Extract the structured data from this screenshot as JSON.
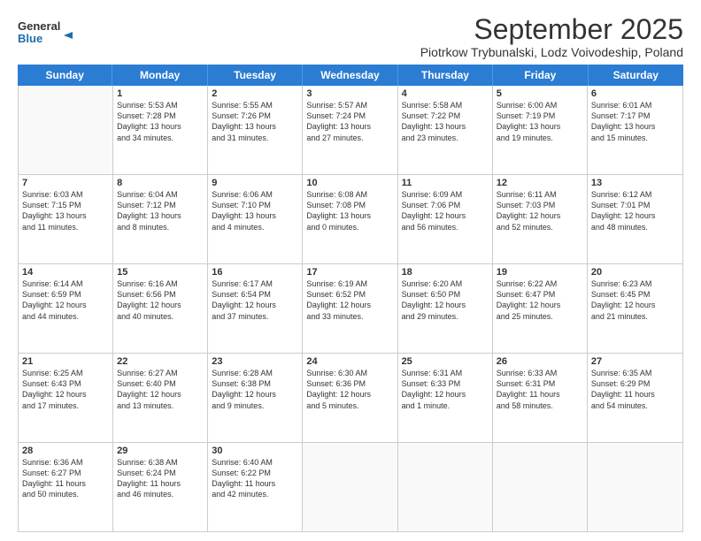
{
  "header": {
    "logo_general": "General",
    "logo_blue": "Blue",
    "month_title": "September 2025",
    "location": "Piotrkow Trybunalski, Lodz Voivodeship, Poland"
  },
  "weekdays": [
    "Sunday",
    "Monday",
    "Tuesday",
    "Wednesday",
    "Thursday",
    "Friday",
    "Saturday"
  ],
  "rows": [
    [
      {
        "day": "",
        "lines": []
      },
      {
        "day": "1",
        "lines": [
          "Sunrise: 5:53 AM",
          "Sunset: 7:28 PM",
          "Daylight: 13 hours",
          "and 34 minutes."
        ]
      },
      {
        "day": "2",
        "lines": [
          "Sunrise: 5:55 AM",
          "Sunset: 7:26 PM",
          "Daylight: 13 hours",
          "and 31 minutes."
        ]
      },
      {
        "day": "3",
        "lines": [
          "Sunrise: 5:57 AM",
          "Sunset: 7:24 PM",
          "Daylight: 13 hours",
          "and 27 minutes."
        ]
      },
      {
        "day": "4",
        "lines": [
          "Sunrise: 5:58 AM",
          "Sunset: 7:22 PM",
          "Daylight: 13 hours",
          "and 23 minutes."
        ]
      },
      {
        "day": "5",
        "lines": [
          "Sunrise: 6:00 AM",
          "Sunset: 7:19 PM",
          "Daylight: 13 hours",
          "and 19 minutes."
        ]
      },
      {
        "day": "6",
        "lines": [
          "Sunrise: 6:01 AM",
          "Sunset: 7:17 PM",
          "Daylight: 13 hours",
          "and 15 minutes."
        ]
      }
    ],
    [
      {
        "day": "7",
        "lines": [
          "Sunrise: 6:03 AM",
          "Sunset: 7:15 PM",
          "Daylight: 13 hours",
          "and 11 minutes."
        ]
      },
      {
        "day": "8",
        "lines": [
          "Sunrise: 6:04 AM",
          "Sunset: 7:12 PM",
          "Daylight: 13 hours",
          "and 8 minutes."
        ]
      },
      {
        "day": "9",
        "lines": [
          "Sunrise: 6:06 AM",
          "Sunset: 7:10 PM",
          "Daylight: 13 hours",
          "and 4 minutes."
        ]
      },
      {
        "day": "10",
        "lines": [
          "Sunrise: 6:08 AM",
          "Sunset: 7:08 PM",
          "Daylight: 13 hours",
          "and 0 minutes."
        ]
      },
      {
        "day": "11",
        "lines": [
          "Sunrise: 6:09 AM",
          "Sunset: 7:06 PM",
          "Daylight: 12 hours",
          "and 56 minutes."
        ]
      },
      {
        "day": "12",
        "lines": [
          "Sunrise: 6:11 AM",
          "Sunset: 7:03 PM",
          "Daylight: 12 hours",
          "and 52 minutes."
        ]
      },
      {
        "day": "13",
        "lines": [
          "Sunrise: 6:12 AM",
          "Sunset: 7:01 PM",
          "Daylight: 12 hours",
          "and 48 minutes."
        ]
      }
    ],
    [
      {
        "day": "14",
        "lines": [
          "Sunrise: 6:14 AM",
          "Sunset: 6:59 PM",
          "Daylight: 12 hours",
          "and 44 minutes."
        ]
      },
      {
        "day": "15",
        "lines": [
          "Sunrise: 6:16 AM",
          "Sunset: 6:56 PM",
          "Daylight: 12 hours",
          "and 40 minutes."
        ]
      },
      {
        "day": "16",
        "lines": [
          "Sunrise: 6:17 AM",
          "Sunset: 6:54 PM",
          "Daylight: 12 hours",
          "and 37 minutes."
        ]
      },
      {
        "day": "17",
        "lines": [
          "Sunrise: 6:19 AM",
          "Sunset: 6:52 PM",
          "Daylight: 12 hours",
          "and 33 minutes."
        ]
      },
      {
        "day": "18",
        "lines": [
          "Sunrise: 6:20 AM",
          "Sunset: 6:50 PM",
          "Daylight: 12 hours",
          "and 29 minutes."
        ]
      },
      {
        "day": "19",
        "lines": [
          "Sunrise: 6:22 AM",
          "Sunset: 6:47 PM",
          "Daylight: 12 hours",
          "and 25 minutes."
        ]
      },
      {
        "day": "20",
        "lines": [
          "Sunrise: 6:23 AM",
          "Sunset: 6:45 PM",
          "Daylight: 12 hours",
          "and 21 minutes."
        ]
      }
    ],
    [
      {
        "day": "21",
        "lines": [
          "Sunrise: 6:25 AM",
          "Sunset: 6:43 PM",
          "Daylight: 12 hours",
          "and 17 minutes."
        ]
      },
      {
        "day": "22",
        "lines": [
          "Sunrise: 6:27 AM",
          "Sunset: 6:40 PM",
          "Daylight: 12 hours",
          "and 13 minutes."
        ]
      },
      {
        "day": "23",
        "lines": [
          "Sunrise: 6:28 AM",
          "Sunset: 6:38 PM",
          "Daylight: 12 hours",
          "and 9 minutes."
        ]
      },
      {
        "day": "24",
        "lines": [
          "Sunrise: 6:30 AM",
          "Sunset: 6:36 PM",
          "Daylight: 12 hours",
          "and 5 minutes."
        ]
      },
      {
        "day": "25",
        "lines": [
          "Sunrise: 6:31 AM",
          "Sunset: 6:33 PM",
          "Daylight: 12 hours",
          "and 1 minute."
        ]
      },
      {
        "day": "26",
        "lines": [
          "Sunrise: 6:33 AM",
          "Sunset: 6:31 PM",
          "Daylight: 11 hours",
          "and 58 minutes."
        ]
      },
      {
        "day": "27",
        "lines": [
          "Sunrise: 6:35 AM",
          "Sunset: 6:29 PM",
          "Daylight: 11 hours",
          "and 54 minutes."
        ]
      }
    ],
    [
      {
        "day": "28",
        "lines": [
          "Sunrise: 6:36 AM",
          "Sunset: 6:27 PM",
          "Daylight: 11 hours",
          "and 50 minutes."
        ]
      },
      {
        "day": "29",
        "lines": [
          "Sunrise: 6:38 AM",
          "Sunset: 6:24 PM",
          "Daylight: 11 hours",
          "and 46 minutes."
        ]
      },
      {
        "day": "30",
        "lines": [
          "Sunrise: 6:40 AM",
          "Sunset: 6:22 PM",
          "Daylight: 11 hours",
          "and 42 minutes."
        ]
      },
      {
        "day": "",
        "lines": []
      },
      {
        "day": "",
        "lines": []
      },
      {
        "day": "",
        "lines": []
      },
      {
        "day": "",
        "lines": []
      }
    ]
  ]
}
